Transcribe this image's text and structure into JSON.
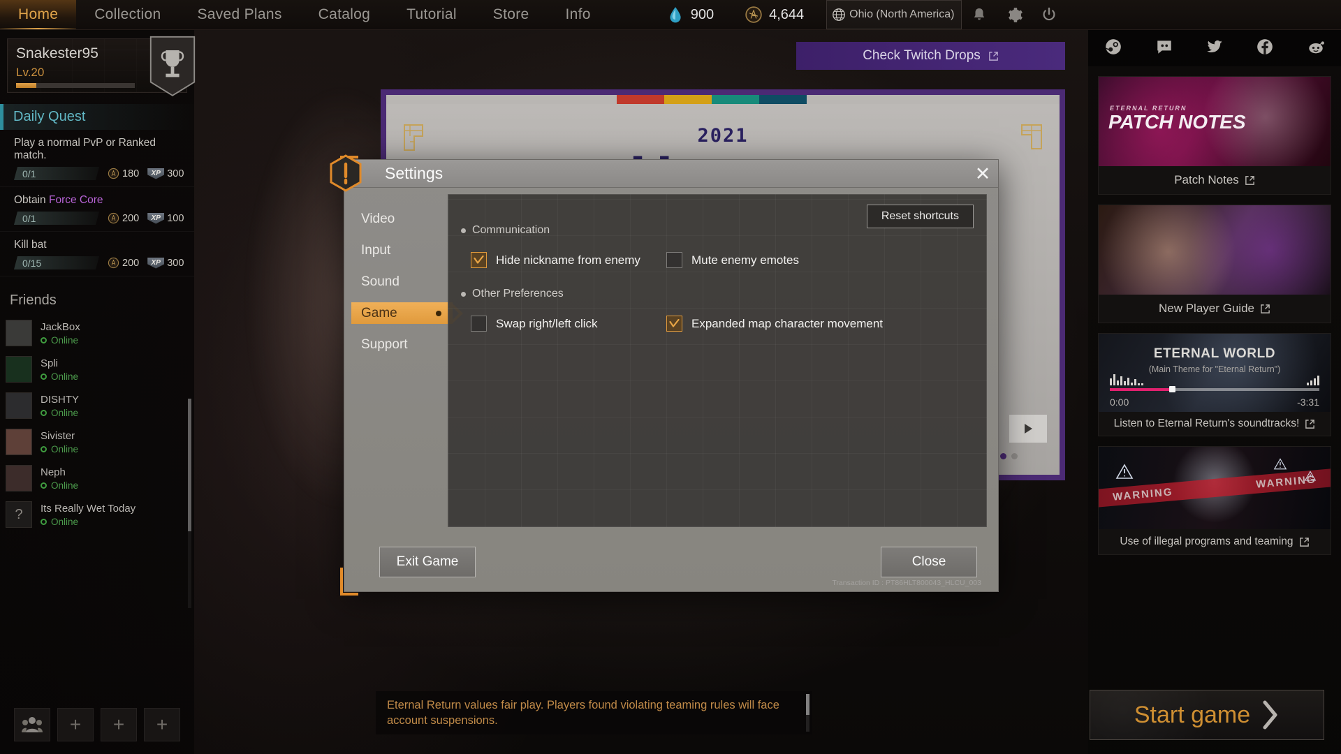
{
  "topnav": {
    "items": [
      {
        "label": "Home",
        "active": true
      },
      {
        "label": "Collection",
        "active": false
      },
      {
        "label": "Saved Plans",
        "active": false
      },
      {
        "label": "Catalog",
        "active": false
      },
      {
        "label": "Tutorial",
        "active": false
      },
      {
        "label": "Store",
        "active": false
      },
      {
        "label": "Info",
        "active": false
      }
    ],
    "currency_a": {
      "icon": "water-drop-icon",
      "value": "900"
    },
    "currency_b": {
      "icon": "a-coin-icon",
      "value": "4,644"
    },
    "region": {
      "icon": "globe-icon",
      "label": "Ohio (North America)"
    },
    "notification_icon": "bell-icon",
    "settings_icon": "gear-icon",
    "power_icon": "power-icon"
  },
  "profile": {
    "name": "Snakester95",
    "level": "Lv.20",
    "xp_percent": 17,
    "trophy_icon": "trophy-icon"
  },
  "daily_quest": {
    "header": "Daily Quest",
    "quests": [
      {
        "title": "Play a normal PvP or Ranked match.",
        "title_prefix": "Play a normal PvP or Ranked match.",
        "highlight": "",
        "progress": "0/1",
        "coin": "180",
        "xp": "300",
        "xp_badge": "XP"
      },
      {
        "title": "Obtain Force Core",
        "title_prefix": "Obtain ",
        "highlight": "Force Core",
        "progress": "0/1",
        "coin": "200",
        "xp": "100",
        "xp_badge": "XP"
      },
      {
        "title": "Kill bat",
        "title_prefix": "Kill bat",
        "highlight": "",
        "progress": "0/15",
        "coin": "200",
        "xp": "300",
        "xp_badge": "XP"
      }
    ]
  },
  "friends": {
    "header": "Friends",
    "items": [
      {
        "name": "JackBox",
        "status": "Online",
        "avatar": "avatar-image"
      },
      {
        "name": "Spli",
        "status": "Online",
        "avatar": "avatar-image"
      },
      {
        "name": "DISHTY",
        "status": "Online",
        "avatar": "avatar-image"
      },
      {
        "name": "Sivister",
        "status": "Online",
        "avatar": "avatar-image"
      },
      {
        "name": "Neph",
        "status": "Online",
        "avatar": "avatar-image"
      },
      {
        "name": "Its Really Wet Today",
        "status": "Online",
        "avatar": "question-mark-icon"
      }
    ]
  },
  "bottom_actions": [
    {
      "icon": "friends-group-icon",
      "label": ""
    },
    {
      "icon": "plus-icon",
      "label": "+"
    },
    {
      "icon": "plus-icon",
      "label": "+"
    },
    {
      "icon": "plus-icon",
      "label": "+"
    }
  ],
  "social": [
    {
      "name": "steam-icon"
    },
    {
      "name": "discord-icon"
    },
    {
      "name": "twitter-icon"
    },
    {
      "name": "facebook-icon"
    },
    {
      "name": "reddit-icon"
    }
  ],
  "promos": {
    "patch_notes": {
      "caption": "Patch Notes",
      "art_title": "PATCH NOTES",
      "art_kicker": "ETERNAL RETURN"
    },
    "new_player_guide": {
      "caption": "New Player Guide"
    },
    "music": {
      "title": "ETERNAL WORLD",
      "subtitle": "(Main Theme for \"Eternal Return\")",
      "time_elapsed": "0:00",
      "time_remaining": "-3:31",
      "progress_percent": 30,
      "caption": "Listen to Eternal Return's soundtracks!",
      "accent_color": "#e0216e"
    },
    "warning": {
      "caption": "Use of illegal programs and teaming",
      "tape_text": "WARNING"
    }
  },
  "twitch_banner": {
    "label": "Check Twitch Drops",
    "icon": "external-link-icon"
  },
  "event_popup": {
    "year": "2021",
    "headline": "Happy",
    "stripe_colors": [
      "#c0392b",
      "#d4a017",
      "#178a7a",
      "#0f4c63"
    ],
    "border_color": "#4b2a74"
  },
  "settings_dialog": {
    "title": "Settings",
    "warn_icon": "warning-hex-icon",
    "close_icon": "close-icon",
    "tabs": [
      {
        "label": "Video",
        "active": false
      },
      {
        "label": "Input",
        "active": false
      },
      {
        "label": "Sound",
        "active": false
      },
      {
        "label": "Game",
        "active": true
      },
      {
        "label": "Support",
        "active": false
      }
    ],
    "reset_button": "Reset shortcuts",
    "groups": [
      {
        "name": "Communication",
        "options": [
          {
            "label": "Hide nickname from enemy",
            "checked": true
          },
          {
            "label": "Mute enemy emotes",
            "checked": false
          }
        ]
      },
      {
        "name": "Other Preferences",
        "options": [
          {
            "label": "Swap right/left click",
            "checked": false
          },
          {
            "label": "Expanded map character movement",
            "checked": true
          }
        ]
      }
    ],
    "exit_button": "Exit Game",
    "close_button": "Close",
    "transaction_id": "Transaction ID : PT86HLT800043_HLCU_003",
    "accent_color": "#e09a3c"
  },
  "notice": {
    "text": "Eternal Return values fair play. Players found violating teaming rules will face account suspensions."
  },
  "start_game": {
    "label": "Start game",
    "chevron": "chevron-right-icon"
  }
}
